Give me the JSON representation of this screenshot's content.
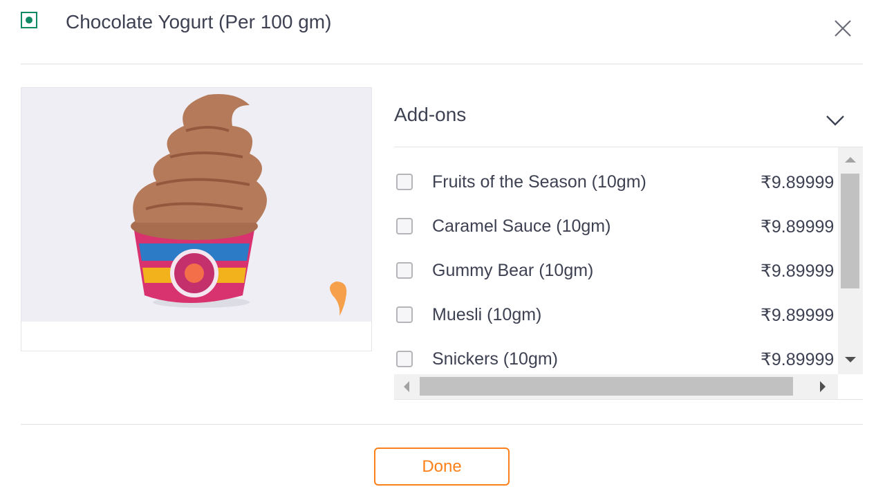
{
  "dialog": {
    "title": "Chocolate Yogurt (Per 100 gm)",
    "veg_indicator_color": "#0f8a65",
    "close_icon": "close-icon",
    "done_label": "Done",
    "accent_color": "#fc8019"
  },
  "addons": {
    "header": "Add-ons",
    "expand_icon": "chevron-down-icon",
    "items": [
      {
        "name": "Fruits of the Season (10gm)",
        "price": "₹9.89999",
        "checked": false
      },
      {
        "name": "Caramel Sauce (10gm)",
        "price": "₹9.89999",
        "checked": false
      },
      {
        "name": "Gummy Bear (10gm)",
        "price": "₹9.89999",
        "checked": false
      },
      {
        "name": "Muesli (10gm)",
        "price": "₹9.89999",
        "checked": false
      },
      {
        "name": "Snickers (10gm)",
        "price": "₹9.89999",
        "checked": false
      }
    ]
  }
}
